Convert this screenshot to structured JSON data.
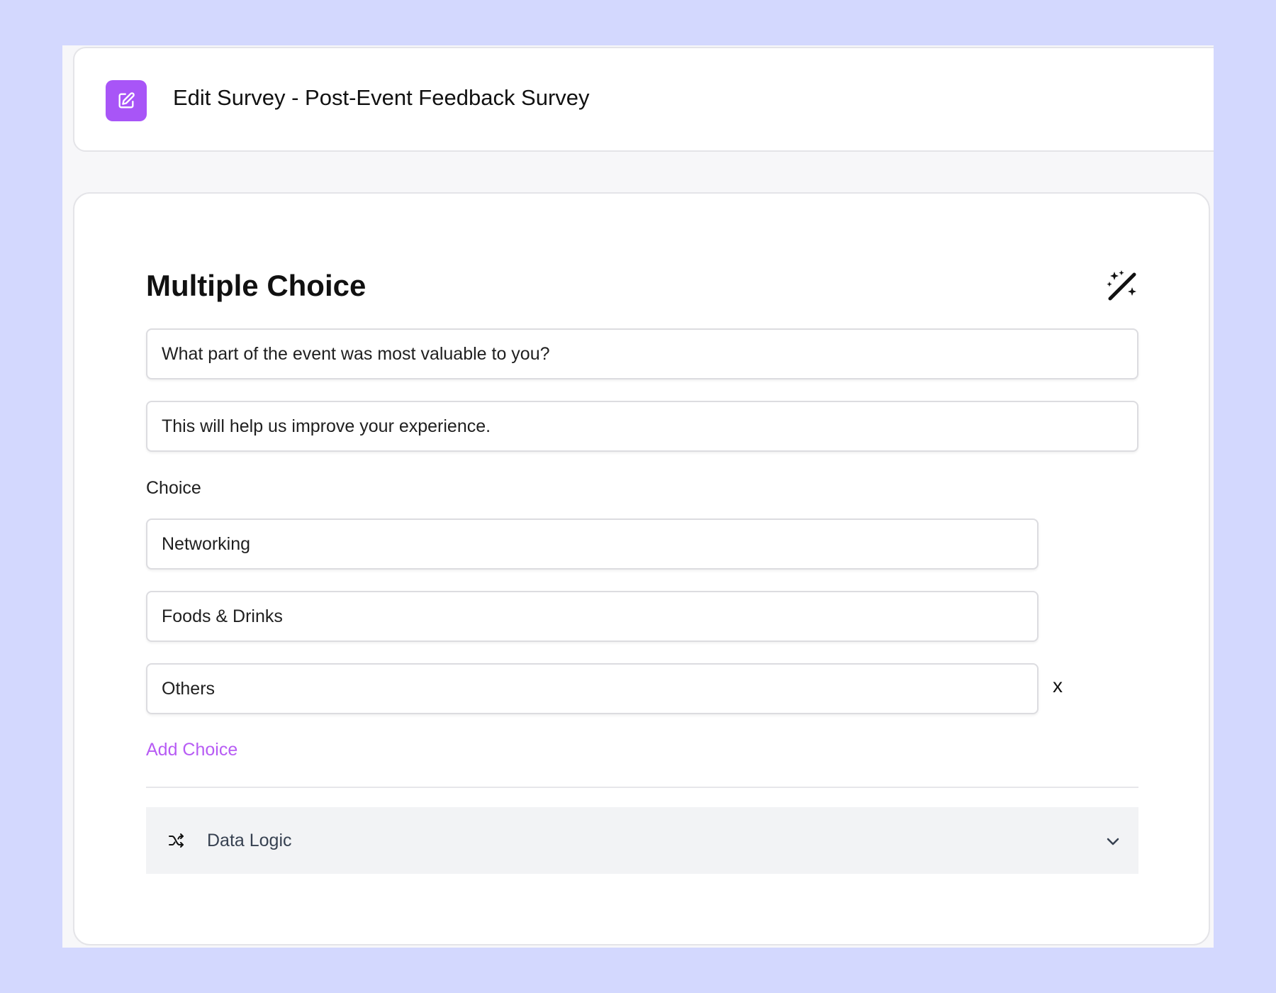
{
  "header": {
    "title": "Edit Survey - Post-Event Feedback Survey",
    "icon": "edit-icon",
    "icon_color": "#a855f7"
  },
  "editor": {
    "question_type": "Multiple Choice",
    "question_text": "What part of the event was most valuable to you?",
    "description_text": "This will help us improve your experience.",
    "choice_label": "Choice",
    "choices": [
      {
        "value": "Networking"
      },
      {
        "value": "Foods & Drinks"
      },
      {
        "value": "Others"
      }
    ],
    "remove_choice_label": "x",
    "add_choice_label": "Add Choice",
    "add_choice_color": "#b75cf4",
    "data_logic": {
      "label": "Data Logic",
      "icon": "shuffle-icon",
      "expand_icon": "chevron-down-icon"
    },
    "magic_icon": "magic-wand-icon"
  },
  "colors": {
    "page_background": "#d3d8fe",
    "app_background": "#f7f7f9",
    "accent": "#a855f7"
  }
}
